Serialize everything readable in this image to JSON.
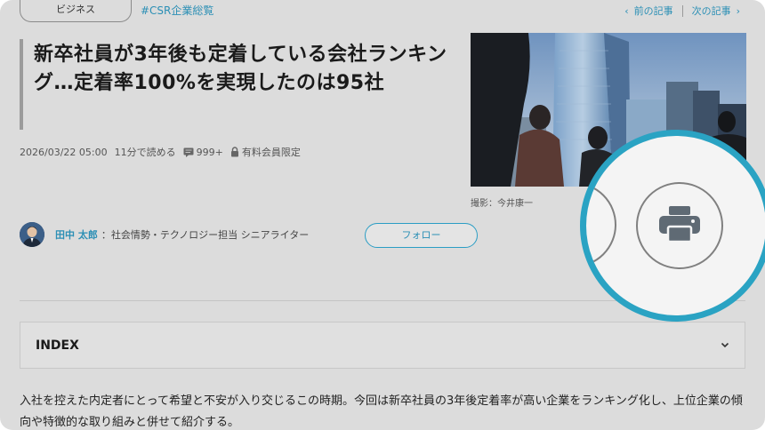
{
  "top": {
    "category": "ビジネス",
    "hashtag": "#CSR企業総覧",
    "prev_article": "前の記事",
    "next_article": "次の記事"
  },
  "article": {
    "title": "新卒社員が3年後も定着している会社ランキング…定着率100%を実現したのは95社",
    "date": "2026/03/22 05:00",
    "read_time": "11分で読める",
    "comment_count": "999+",
    "members_only": "有料会員限定",
    "photo_credit": "撮影：今井康一"
  },
  "author": {
    "name": "田中 太郎",
    "role": "：社会情勢・テクノロジー担当 シニアライター",
    "follow_label": "フォロー"
  },
  "index": {
    "label": "INDEX"
  },
  "intro": {
    "text": "入社を控えた内定者にとって希望と不安が入り交じるこの時期。今回は新卒社員の3年後定着率が高い企業をランキング化し、上位企業の傾向や特徴的な取り組みと併せて紹介する。"
  },
  "colors": {
    "accent": "#2b8fb5",
    "magnifier_ring": "#2aa3c3",
    "background": "#dcdcdc"
  }
}
